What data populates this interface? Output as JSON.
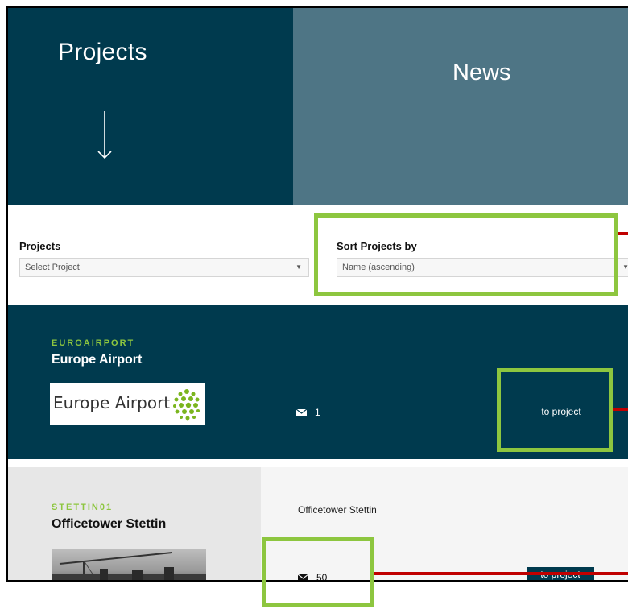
{
  "header": {
    "projects_tile": "Projects",
    "projects_arrow": "↓",
    "news_tile": "News"
  },
  "filters": {
    "projects_label": "Projects",
    "projects_select": "Select Project",
    "sort_label": "Sort Projects by",
    "sort_select": "Name (ascending)"
  },
  "projects": [
    {
      "code": "EUROAIRPORT",
      "name": "Europe Airport",
      "logo_text": "Europe Airport",
      "message_count": "1",
      "cta": "to project"
    },
    {
      "code": "STETTIN01",
      "name": "Officetower Stettin",
      "description": "Officetower Stettin",
      "message_count": "50",
      "cta": "to project"
    }
  ],
  "colors": {
    "dark_teal": "#003a4e",
    "news_teal": "#4e7585",
    "accent_green": "#8dc63f",
    "annotation_red": "#c00000"
  },
  "icons": {
    "arrow": "arrow-down-icon",
    "dropdown": "caret-down-icon",
    "messages": "envelope-icon"
  }
}
